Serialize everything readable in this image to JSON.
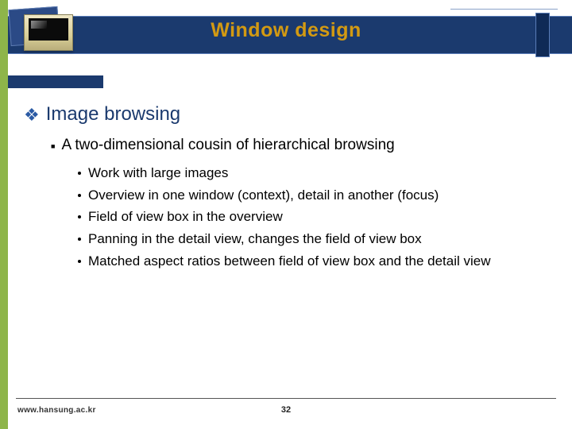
{
  "header": {
    "title": "Window design"
  },
  "content": {
    "heading": "Image browsing",
    "sub1": "A two-dimensional cousin of hierarchical browsing",
    "bullets": [
      "Work with large images",
      "Overview in one window (context), detail in another (focus)",
      "Field of view box in the overview",
      "Panning in the detail view, changes the field of view box",
      "Matched aspect ratios between field of view box and the detail view"
    ]
  },
  "footer": {
    "url": "www.hansung.ac.kr",
    "page": "32"
  }
}
